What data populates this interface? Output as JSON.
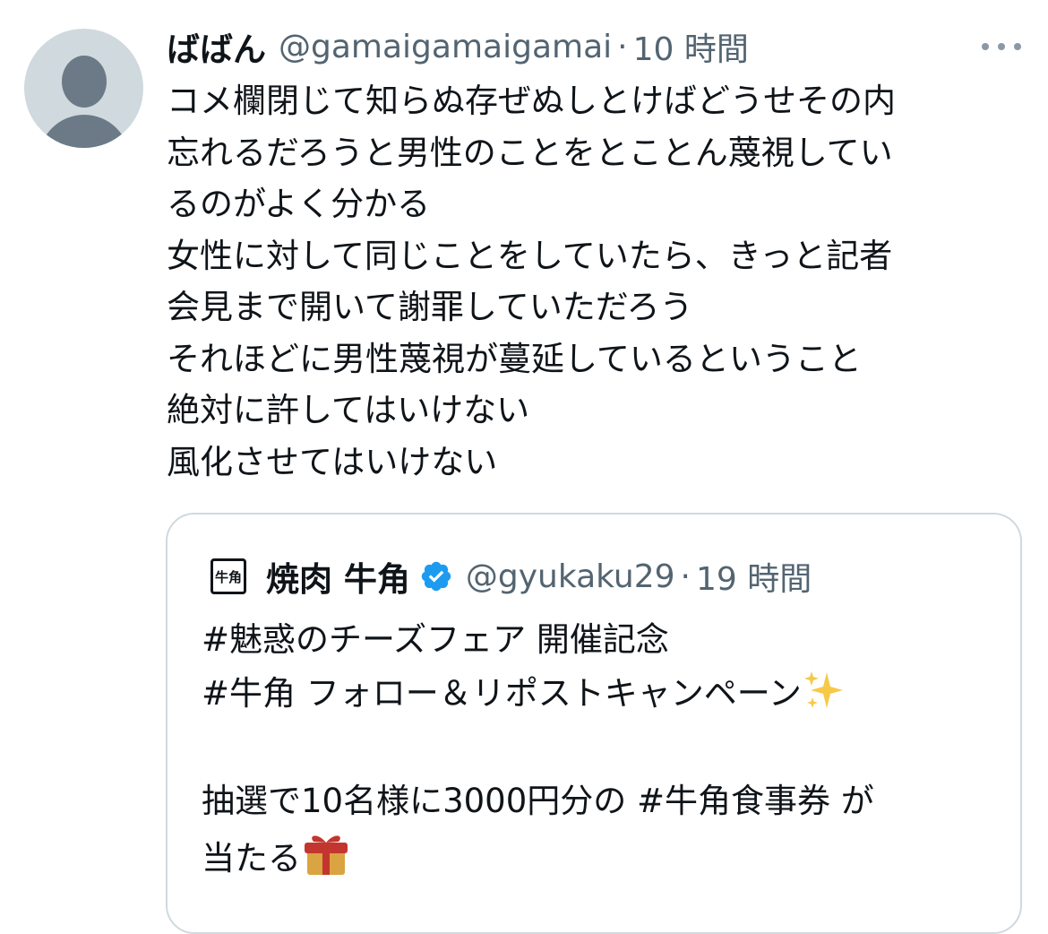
{
  "tweet": {
    "display_name": "ばばん",
    "handle": "@gamaigamaigamai",
    "separator": "·",
    "time": "10 時間",
    "lines": [
      "コメ欄閉じて知らぬ存ぜぬしとけばどうせその内",
      "忘れるだろうと男性のことをとことん蔑視してい",
      "るのがよく分かる",
      "女性に対して同じことをしていたら、きっと記者",
      "会見まで開いて謝罪していただろう",
      "それほどに男性蔑視が蔓延しているということ",
      "絶対に許してはいけない",
      "風化させてはいけない"
    ],
    "more_icon": "more-horizontal-icon",
    "avatar_icon": "default-profile-icon"
  },
  "quote": {
    "logo_text": "牛角",
    "display_name": "焼肉 牛角",
    "verified_icon": "verified-badge-icon",
    "handle": "@gyukaku29",
    "separator": "·",
    "time": "19 時間",
    "line1": "#魅惑のチーズフェア 開催記念",
    "line2": "#牛角 フォロー＆リポストキャンペーン",
    "line3": "",
    "line4": "抽選で10名様に3000円分の #牛角食事券 が",
    "line5": "当たる",
    "sparkle_icon": "sparkles-emoji-icon",
    "gift_icon": "gift-emoji-icon"
  },
  "colors": {
    "text_primary": "#0f1419",
    "text_secondary": "#536471",
    "verified_blue": "#1d9bf0",
    "border": "#cfd9de"
  }
}
